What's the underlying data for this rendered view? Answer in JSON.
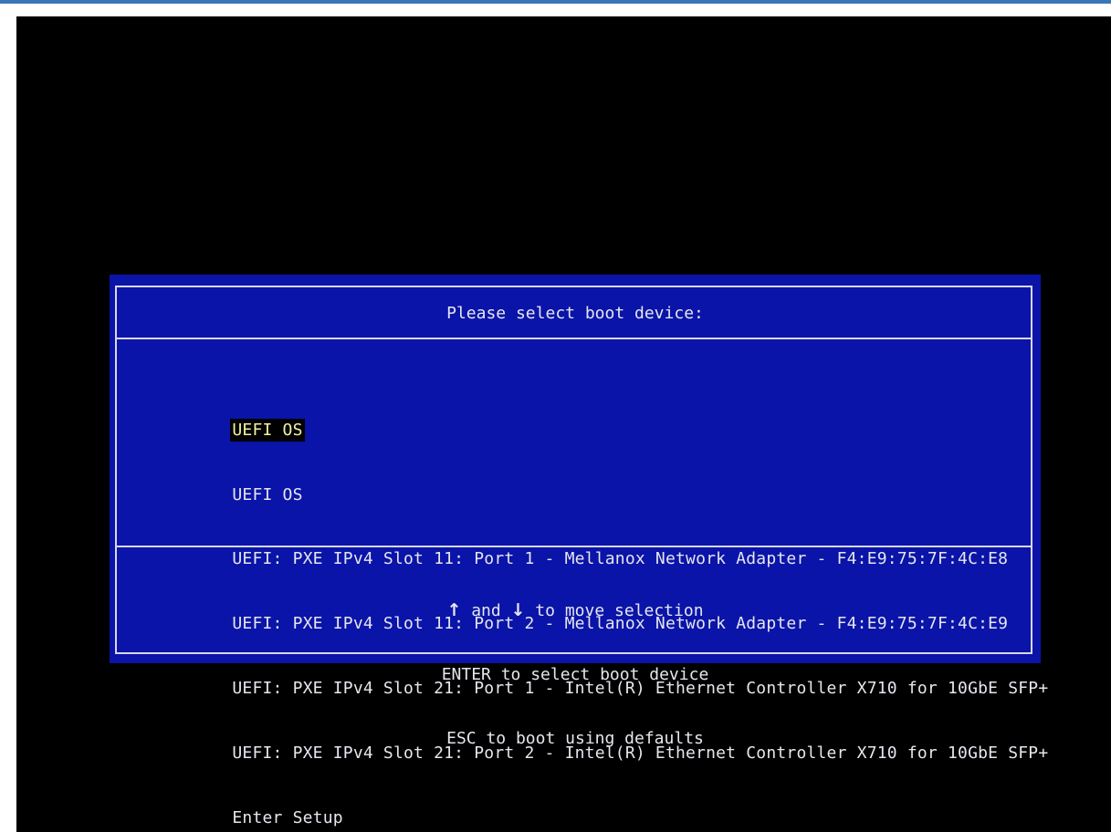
{
  "dialog": {
    "title": "Please select boot device:",
    "boot_devices": [
      {
        "label": "UEFI OS",
        "selected": true
      },
      {
        "label": "UEFI OS",
        "selected": false
      },
      {
        "label": "UEFI: PXE IPv4 Slot 11: Port 1 - Mellanox Network Adapter - F4:E9:75:7F:4C:E8",
        "selected": false
      },
      {
        "label": "UEFI: PXE IPv4 Slot 11: Port 2 - Mellanox Network Adapter - F4:E9:75:7F:4C:E9",
        "selected": false
      },
      {
        "label": "UEFI: PXE IPv4 Slot 21: Port 1 - Intel(R) Ethernet Controller X710 for 10GbE SFP+",
        "selected": false
      },
      {
        "label": "UEFI: PXE IPv4 Slot 21: Port 2 - Intel(R) Ethernet Controller X710 for 10GbE SFP+",
        "selected": false
      },
      {
        "label": "Enter Setup",
        "selected": false
      }
    ],
    "help": {
      "up_arrow": "↑",
      "and_text": " and ",
      "down_arrow": "↓",
      "move_text": " to move selection",
      "enter_line": "ENTER to select boot device",
      "esc_line": "ESC to boot using defaults"
    }
  },
  "colors": {
    "screen_background": "#000000",
    "dialog_background": "#0a14a8",
    "dialog_text": "#e6e6ee",
    "selection_background": "#000000",
    "selection_text": "#f2f2a0",
    "window_top_bar": "#3b77b8"
  }
}
